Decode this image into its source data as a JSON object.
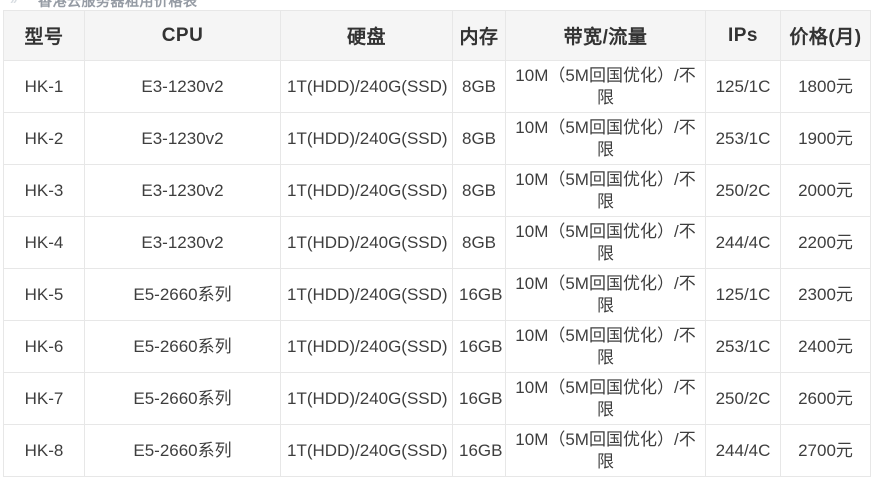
{
  "page": {
    "clipped_heading": "香港云服务器租用价格表",
    "chevron_icon": "double-chevron-right-icon"
  },
  "table": {
    "columns": [
      {
        "key": "model",
        "label": "型号"
      },
      {
        "key": "cpu",
        "label": "CPU"
      },
      {
        "key": "disk",
        "label": "硬盘"
      },
      {
        "key": "memory",
        "label": "内存"
      },
      {
        "key": "bandwidth",
        "label": "带宽/流量"
      },
      {
        "key": "ips",
        "label": "IPs"
      },
      {
        "key": "price",
        "label": "价格(月)"
      }
    ],
    "rows": [
      {
        "model": "HK-1",
        "cpu": "E3-1230v2",
        "disk": "1T(HDD)/240G(SSD)",
        "memory": "8GB",
        "bandwidth": "10M（5M回国优化）/不限",
        "ips": "125/1C",
        "price": "1800元"
      },
      {
        "model": "HK-2",
        "cpu": "E3-1230v2",
        "disk": "1T(HDD)/240G(SSD)",
        "memory": "8GB",
        "bandwidth": "10M（5M回国优化）/不限",
        "ips": "253/1C",
        "price": "1900元"
      },
      {
        "model": "HK-3",
        "cpu": "E3-1230v2",
        "disk": "1T(HDD)/240G(SSD)",
        "memory": "8GB",
        "bandwidth": "10M（5M回国优化）/不限",
        "ips": "250/2C",
        "price": "2000元"
      },
      {
        "model": "HK-4",
        "cpu": "E3-1230v2",
        "disk": "1T(HDD)/240G(SSD)",
        "memory": "8GB",
        "bandwidth": "10M（5M回国优化）/不限",
        "ips": "244/4C",
        "price": "2200元"
      },
      {
        "model": "HK-5",
        "cpu": "E5-2660系列",
        "disk": "1T(HDD)/240G(SSD)",
        "memory": "16GB",
        "bandwidth": "10M（5M回国优化）/不限",
        "ips": "125/1C",
        "price": "2300元"
      },
      {
        "model": "HK-6",
        "cpu": "E5-2660系列",
        "disk": "1T(HDD)/240G(SSD)",
        "memory": "16GB",
        "bandwidth": "10M（5M回国优化）/不限",
        "ips": "253/1C",
        "price": "2400元"
      },
      {
        "model": "HK-7",
        "cpu": "E5-2660系列",
        "disk": "1T(HDD)/240G(SSD)",
        "memory": "16GB",
        "bandwidth": "10M（5M回国优化）/不限",
        "ips": "250/2C",
        "price": "2600元"
      },
      {
        "model": "HK-8",
        "cpu": "E5-2660系列",
        "disk": "1T(HDD)/240G(SSD)",
        "memory": "16GB",
        "bandwidth": "10M（5M回国优化）/不限",
        "ips": "244/4C",
        "price": "2700元"
      }
    ]
  },
  "colors": {
    "price_red": "#d81e1e",
    "header_background": "#f5f5f5",
    "border": "#e7e7e7",
    "text": "#3e3e3e"
  }
}
